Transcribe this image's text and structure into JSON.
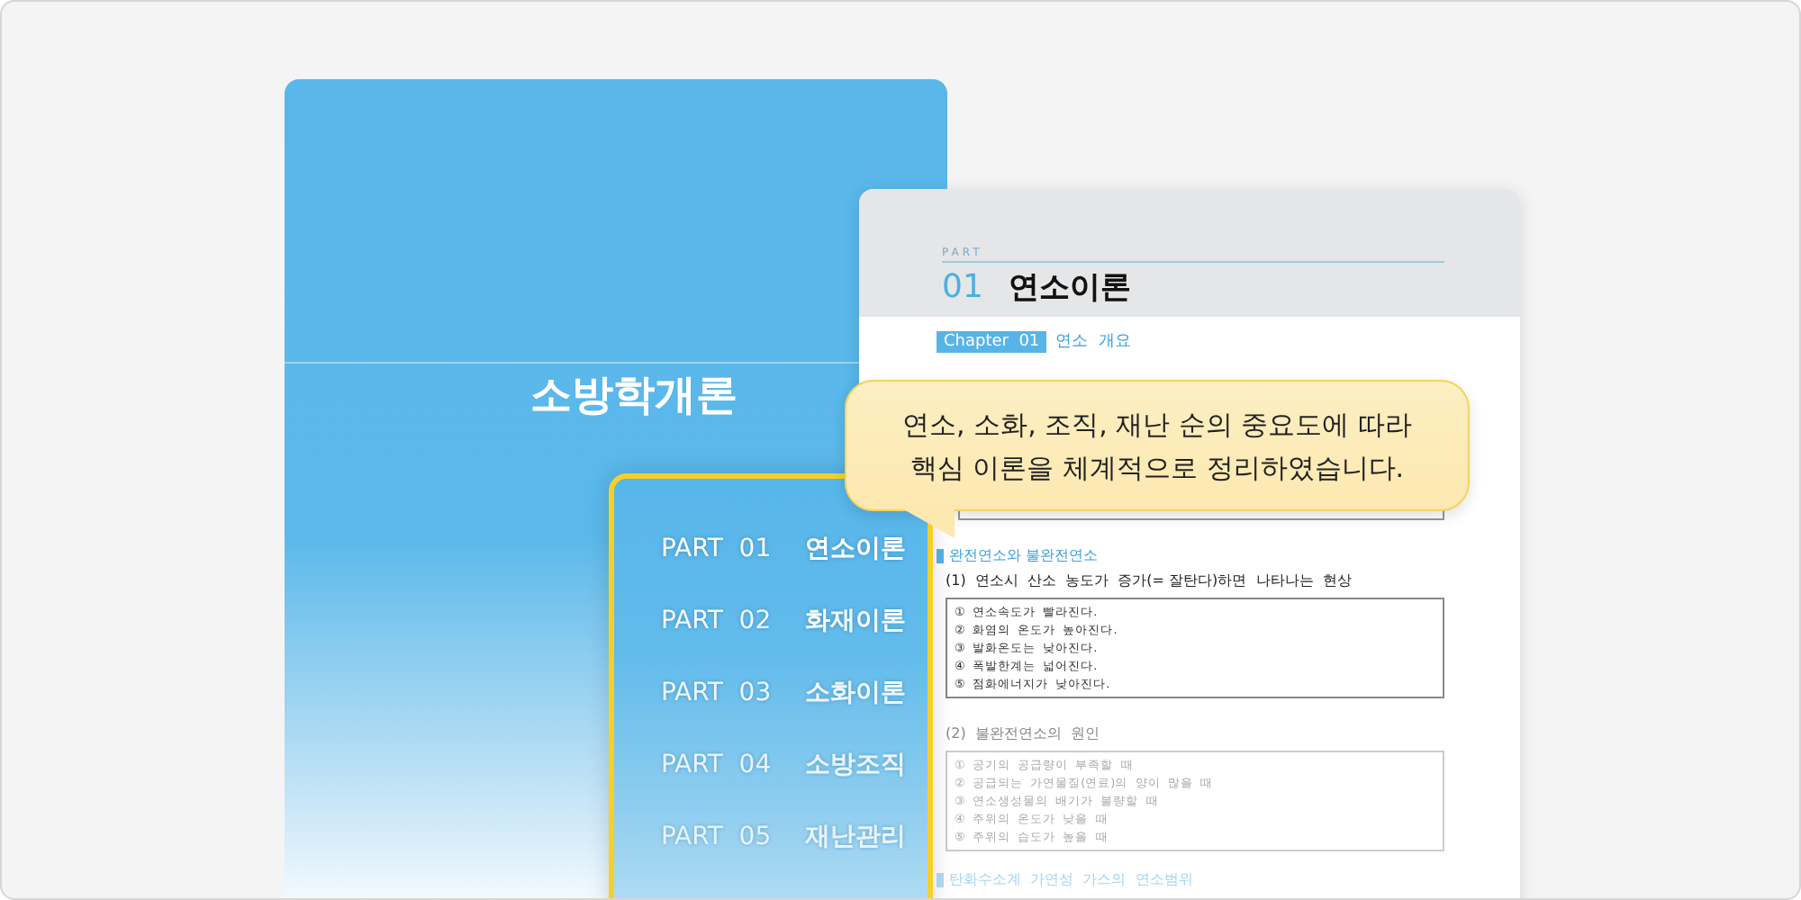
{
  "book_cover": {
    "title": "소방학개론"
  },
  "parts": [
    {
      "label": "PART  01",
      "name": "연소이론"
    },
    {
      "label": "PART  02",
      "name": "화재이론"
    },
    {
      "label": "PART  03",
      "name": "소화이론"
    },
    {
      "label": "PART  04",
      "name": "소방조직"
    },
    {
      "label": "PART  05",
      "name": "재난관리"
    }
  ],
  "sample_page": {
    "part_label": "PART",
    "part_number": "01",
    "part_title": "연소이론",
    "chapter_badge": "Chapter  01",
    "chapter_title": "연소  개요",
    "sections": [
      {
        "heading": "완전연소와 불완전연소",
        "blocks": [
          {
            "title": "(1)  연소시  산소  농도가  증가(= 잘탄다)하면  나타나는  현상",
            "items": [
              "①  연소속도가  빨라진다.",
              "②  화염의  온도가  높아진다.",
              "③  발화온도는  낮아진다.",
              "④  폭발한계는  넓어진다.",
              "⑤  점화에너지가  낮아진다."
            ]
          },
          {
            "title": "(2)  불완전연소의  원인",
            "items": [
              "①  공기의  공급량이  부족할  때",
              "②  공급되는  가연물질(연료)의  양이  많을  때",
              "③  연소생성물의  배기가  불량할  때",
              "④  주위의  온도가  낮을  때",
              "⑤  주위의  습도가  높을  때"
            ]
          }
        ]
      },
      {
        "heading": "탄화수소계  가연성  가스의  연소범위"
      }
    ]
  },
  "callout": {
    "lines": [
      "연소, 소화, 조직, 재난 순의 중요도에 따라",
      "핵심 이론을 체계적으로 정리하였습니다."
    ]
  }
}
